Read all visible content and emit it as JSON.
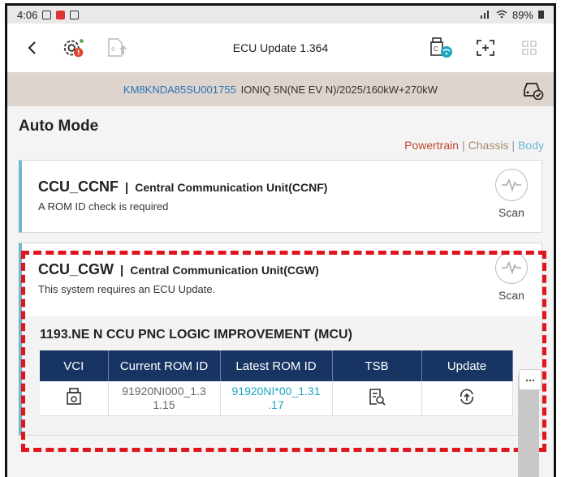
{
  "status_bar": {
    "time": "4:06",
    "battery": "89%"
  },
  "toolbar": {
    "title": "ECU Update 1.364",
    "back_icon": "chevron-left-icon",
    "left_icons": [
      "gear-alert-icon",
      "document-upload-icon"
    ],
    "right_icons": [
      "vci-wifi-icon",
      "scan-frame-icon",
      "grid-icon"
    ]
  },
  "vehicle": {
    "vin": "KM8KNDA85SU001755",
    "description": "IONIQ 5N(NE EV N)/2025/160kW+270kW"
  },
  "mode": {
    "title": "Auto Mode",
    "filters": [
      "Powertrain",
      "Chassis",
      "Body"
    ],
    "filter_colors": [
      "#c0472f",
      "#a48a6d",
      "#6fb8d2"
    ]
  },
  "cards": [
    {
      "code": "CCU_CCNF",
      "name": "Central Communication Unit(CCNF)",
      "description": "A ROM ID check is required",
      "action": "Scan"
    },
    {
      "code": "CCU_CGW",
      "name": "Central Communication Unit(CGW)",
      "description": "This system requires an ECU Update.",
      "action": "Scan"
    }
  ],
  "update": {
    "title": "1193.NE N CCU PNC LOGIC IMPROVEMENT (MCU)",
    "columns": [
      "VCI",
      "Current ROM ID",
      "Latest ROM ID",
      "TSB",
      "Update"
    ],
    "row": {
      "current_line1": "91920NI000_1.3",
      "current_line2": "1.15",
      "latest_line1": "91920NI*00_1.31",
      "latest_line2": ".17"
    },
    "more": "..."
  }
}
